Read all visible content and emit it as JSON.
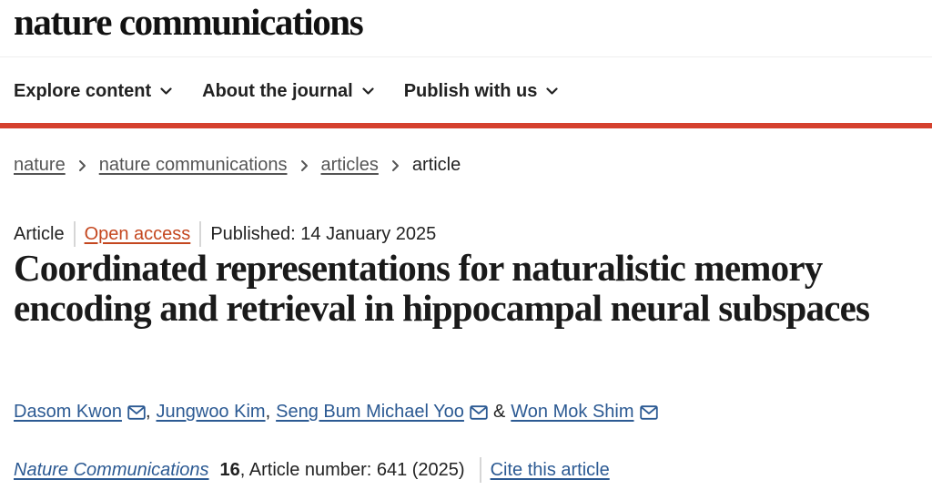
{
  "masthead": {
    "logo_text": "nature communications"
  },
  "nav": {
    "items": [
      {
        "label": "Explore content",
        "icon": "chevron-down-icon"
      },
      {
        "label": "About the journal",
        "icon": "chevron-down-icon"
      },
      {
        "label": "Publish with us",
        "icon": "chevron-down-icon"
      }
    ]
  },
  "breadcrumb": {
    "items": [
      "nature",
      "nature communications",
      "articles"
    ],
    "current": "article"
  },
  "article": {
    "type": "Article",
    "access": "Open access",
    "published": "Published: 14 January 2025",
    "title": "Coordinated representations for naturalistic memory encoding and retrieval in hippocampal neural subspaces",
    "authors": [
      "Dasom Kwon",
      "Jungwoo Kim",
      "Seng Bum Michael Yoo",
      "Won Mok Shim"
    ],
    "author_separators": [
      ",",
      ",",
      "&"
    ],
    "citation": {
      "journal": "Nature Communications",
      "volume": "16",
      "article_number": ", Article number: 641 (2025)",
      "cite_label": "Cite this article"
    }
  },
  "colors": {
    "accent_red": "#d5412e",
    "link_blue": "#2c5a93",
    "open_access_orange": "#c4471f"
  }
}
